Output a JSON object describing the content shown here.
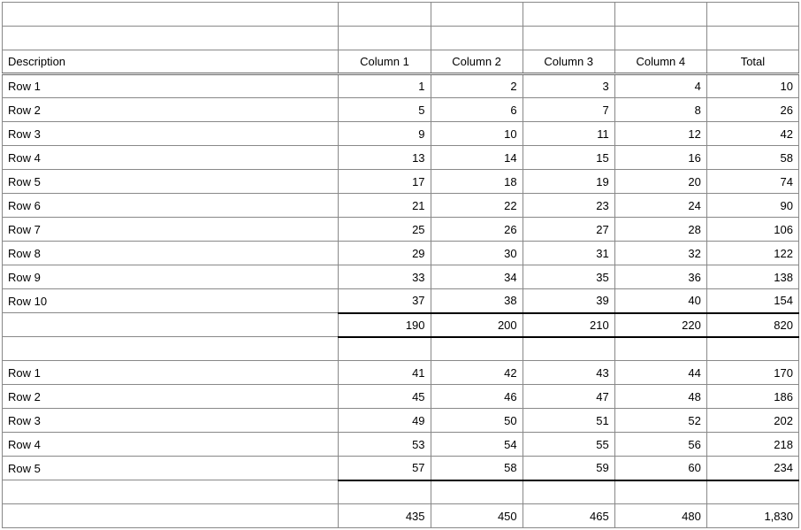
{
  "headers": {
    "description": "Description",
    "col1": "Column 1",
    "col2": "Column 2",
    "col3": "Column 3",
    "col4": "Column 4",
    "total": "Total"
  },
  "section1": {
    "rows": [
      {
        "label": "Row 1",
        "c1": "1",
        "c2": "2",
        "c3": "3",
        "c4": "4",
        "total": "10"
      },
      {
        "label": "Row 2",
        "c1": "5",
        "c2": "6",
        "c3": "7",
        "c4": "8",
        "total": "26"
      },
      {
        "label": "Row 3",
        "c1": "9",
        "c2": "10",
        "c3": "11",
        "c4": "12",
        "total": "42"
      },
      {
        "label": "Row 4",
        "c1": "13",
        "c2": "14",
        "c3": "15",
        "c4": "16",
        "total": "58"
      },
      {
        "label": "Row 5",
        "c1": "17",
        "c2": "18",
        "c3": "19",
        "c4": "20",
        "total": "74"
      },
      {
        "label": "Row 6",
        "c1": "21",
        "c2": "22",
        "c3": "23",
        "c4": "24",
        "total": "90"
      },
      {
        "label": "Row 7",
        "c1": "25",
        "c2": "26",
        "c3": "27",
        "c4": "28",
        "total": "106"
      },
      {
        "label": "Row 8",
        "c1": "29",
        "c2": "30",
        "c3": "31",
        "c4": "32",
        "total": "122"
      },
      {
        "label": "Row 9",
        "c1": "33",
        "c2": "34",
        "c3": "35",
        "c4": "36",
        "total": "138"
      },
      {
        "label": "Row 10",
        "c1": "37",
        "c2": "38",
        "c3": "39",
        "c4": "40",
        "total": "154"
      }
    ],
    "subtotal": {
      "c1": "190",
      "c2": "200",
      "c3": "210",
      "c4": "220",
      "total": "820"
    }
  },
  "section2": {
    "rows": [
      {
        "label": "Row 1",
        "c1": "41",
        "c2": "42",
        "c3": "43",
        "c4": "44",
        "total": "170"
      },
      {
        "label": "Row 2",
        "c1": "45",
        "c2": "46",
        "c3": "47",
        "c4": "48",
        "total": "186"
      },
      {
        "label": "Row 3",
        "c1": "49",
        "c2": "50",
        "c3": "51",
        "c4": "52",
        "total": "202"
      },
      {
        "label": "Row 4",
        "c1": "53",
        "c2": "54",
        "c3": "55",
        "c4": "56",
        "total": "218"
      },
      {
        "label": "Row 5",
        "c1": "57",
        "c2": "58",
        "c3": "59",
        "c4": "60",
        "total": "234"
      }
    ]
  },
  "grand_total": {
    "c1": "435",
    "c2": "450",
    "c3": "465",
    "c4": "480",
    "total": "1,830"
  },
  "chart_data": {
    "type": "table",
    "columns": [
      "Description",
      "Column 1",
      "Column 2",
      "Column 3",
      "Column 4",
      "Total"
    ],
    "sections": [
      {
        "rows": [
          [
            "Row 1",
            1,
            2,
            3,
            4,
            10
          ],
          [
            "Row 2",
            5,
            6,
            7,
            8,
            26
          ],
          [
            "Row 3",
            9,
            10,
            11,
            12,
            42
          ],
          [
            "Row 4",
            13,
            14,
            15,
            16,
            58
          ],
          [
            "Row 5",
            17,
            18,
            19,
            20,
            74
          ],
          [
            "Row 6",
            21,
            22,
            23,
            24,
            90
          ],
          [
            "Row 7",
            25,
            26,
            27,
            28,
            106
          ],
          [
            "Row 8",
            29,
            30,
            31,
            32,
            122
          ],
          [
            "Row 9",
            33,
            34,
            35,
            36,
            138
          ],
          [
            "Row 10",
            37,
            38,
            39,
            40,
            154
          ]
        ],
        "subtotal": [
          "",
          190,
          200,
          210,
          220,
          820
        ]
      },
      {
        "rows": [
          [
            "Row 1",
            41,
            42,
            43,
            44,
            170
          ],
          [
            "Row 2",
            45,
            46,
            47,
            48,
            186
          ],
          [
            "Row 3",
            49,
            50,
            51,
            52,
            202
          ],
          [
            "Row 4",
            53,
            54,
            55,
            56,
            218
          ],
          [
            "Row 5",
            57,
            58,
            59,
            60,
            234
          ]
        ]
      }
    ],
    "grand_total": [
      "",
      435,
      450,
      465,
      480,
      1830
    ]
  }
}
